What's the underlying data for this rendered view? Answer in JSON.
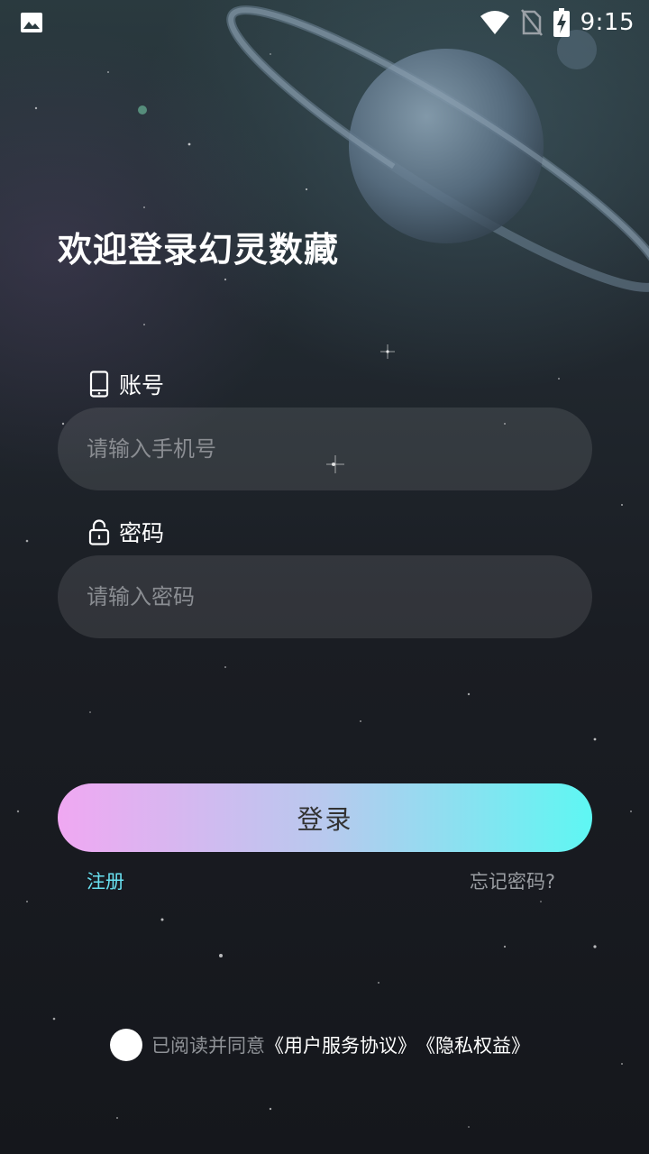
{
  "status_bar": {
    "time": "9:15",
    "icons": [
      "image-notification-icon",
      "wifi-icon",
      "no-sim-icon",
      "battery-charging-icon"
    ]
  },
  "welcome": {
    "title": "欢迎登录幻灵数藏"
  },
  "account": {
    "label": "账号",
    "icon": "phone-icon",
    "placeholder": "请输入手机号",
    "value": ""
  },
  "password": {
    "label": "密码",
    "icon": "lock-icon",
    "placeholder": "请输入密码",
    "value": ""
  },
  "login_button": {
    "label": "登录"
  },
  "links": {
    "register": "注册",
    "forgot_password": "忘记密码?"
  },
  "agreement": {
    "checked": false,
    "prefix": "已阅读并同意",
    "user_agreement": "《用户服务协议》",
    "privacy": "《隐私权益》"
  },
  "colors": {
    "accent_cyan": "#69e0f0",
    "button_gradient_start": "#f0a8f2",
    "button_gradient_end": "#5ef7f3"
  }
}
